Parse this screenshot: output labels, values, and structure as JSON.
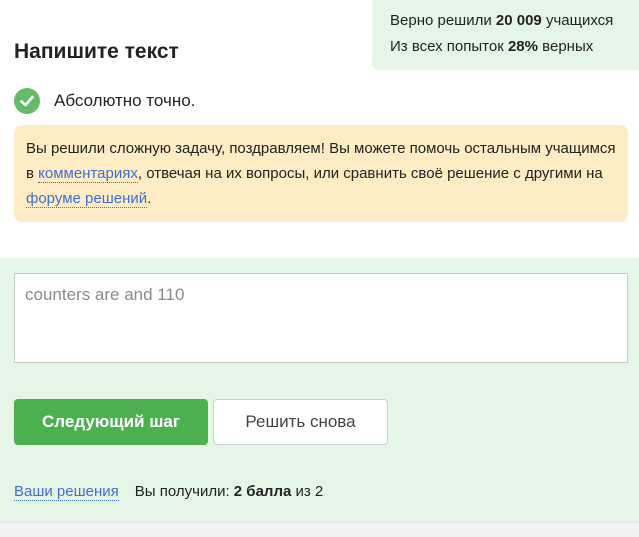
{
  "stats": {
    "solved_prefix": "Верно решили",
    "solved_count": "20 009",
    "solved_suffix": "учащихся",
    "attempts_prefix": "Из всех попыток",
    "attempts_percent": "28%",
    "attempts_suffix": "верных"
  },
  "task": {
    "title": "Напишите текст"
  },
  "result": {
    "status_icon": "checkmark-icon",
    "text": "Абсолютно точно."
  },
  "notice": {
    "part1": "Вы решили сложную задачу, поздравляем! Вы можете помочь остальным учащимся в ",
    "comments_link": "комментариях",
    "part2": ", отвечая на их вопросы, или сравнить своё решение с другими на ",
    "forum_link": "форуме решений",
    "part3": "."
  },
  "answer": {
    "value": "counters are  and 110"
  },
  "buttons": {
    "next": "Следующий шаг",
    "retry": "Решить снова"
  },
  "footer": {
    "solutions_link": "Ваши решения",
    "score_prefix": "Вы получили:",
    "score_value": "2 балла",
    "score_suffix": "из 2"
  },
  "colors": {
    "accent_green": "#4caf50",
    "check_green": "#66bb6a",
    "light_green_bg": "#e6f6e6",
    "notice_bg": "#feedc4",
    "link_blue": "#3e6fd6"
  }
}
